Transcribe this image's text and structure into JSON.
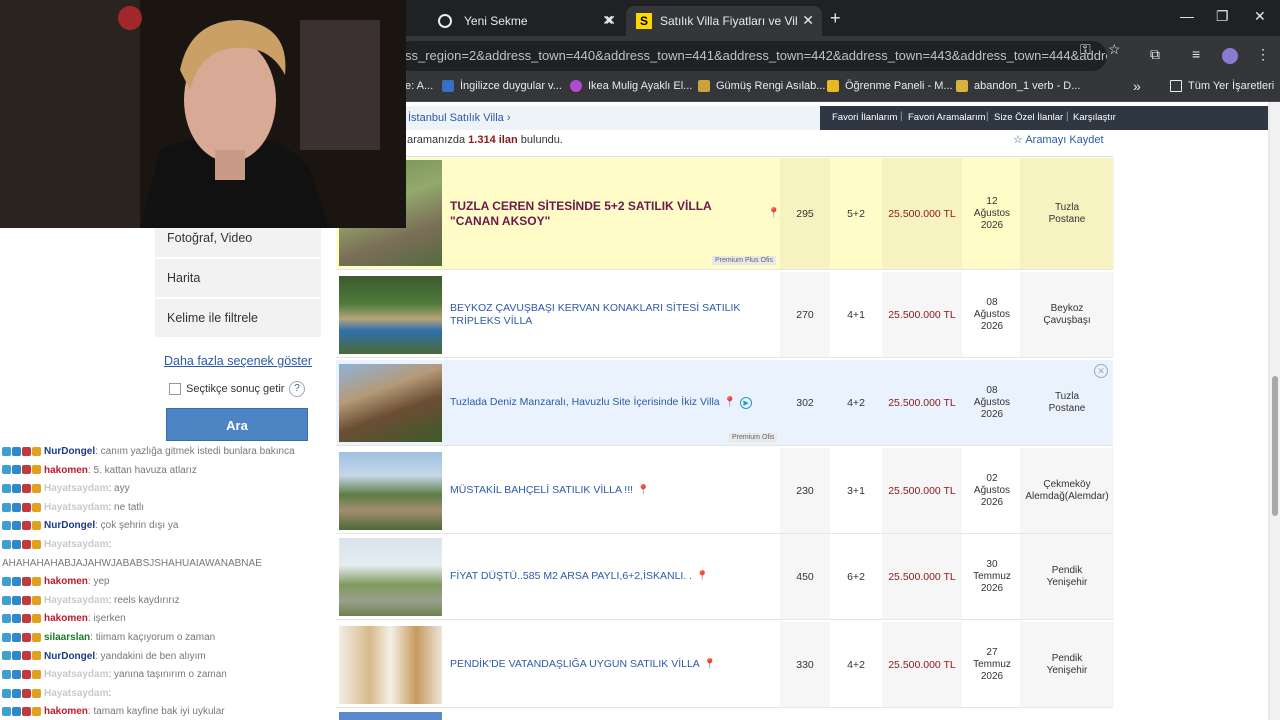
{
  "browser": {
    "tabs": [
      {
        "label": "Yeni Sekme",
        "active": false
      },
      {
        "label": "Satılık Villa Fiyatları ve Villa İlanları",
        "active": true
      }
    ],
    "url": "ss_region=2&address_town=440&address_town=441&address_town=442&address_town=443&address_town=444&address_t...",
    "bookmarks": [
      {
        "label": "e: A..."
      },
      {
        "label": "İngilizce duygular v..."
      },
      {
        "label": "Ikea Mulig Ayaklı El..."
      },
      {
        "label": "Gümüş Rengi Asılab..."
      },
      {
        "label": "Öğrenme Paneli - M..."
      },
      {
        "label": "abandon_1 verb - D..."
      }
    ],
    "bookmarks_overflow": "»",
    "all_bookmarks": "Tüm Yer İşaretleri"
  },
  "page": {
    "breadcrumb": "İstanbul Satılık Villa",
    "breadcrumb_sep": "›",
    "user_links": [
      "Favori İlanlarım",
      "Favori Aramalarım",
      "Size Özel İlanlar",
      "Karşılaştır"
    ],
    "result_prefix": "aramanızda",
    "result_count": "1.314 ilan",
    "result_suffix": "bulundu.",
    "save_search": "Aramayı Kaydet"
  },
  "sidebar": {
    "items": [
      "Fotoğraf, Video",
      "Harita",
      "Kelime ile filtrele"
    ],
    "more_filters": "Daha fazla seçenek göster",
    "checkbox_label": "Seçtikçe sonuç getir",
    "help": "?",
    "search_button": "Ara"
  },
  "listings": [
    {
      "title": "TUZLA CEREN SİTESİNDE 5+2 SATILIK VİLLA \"CANAN AKSOY\"",
      "m2": "295",
      "rooms": "5+2",
      "price": "25.500.000 TL",
      "date": [
        "12",
        "Ağustos",
        "2026"
      ],
      "loc": [
        "Tuzla",
        "Postane"
      ],
      "badge": "Premium Plus Ofis"
    },
    {
      "title": "BEYKOZ ÇAVUŞBAŞI KERVAN KONAKLARI SİTESİ SATILIK TRİPLEKS VİLLA",
      "m2": "270",
      "rooms": "4+1",
      "price": "25.500.000 TL",
      "date": [
        "08",
        "Ağustos",
        "2026"
      ],
      "loc": [
        "Beykoz",
        "Çavuşbaşı"
      ],
      "badge": ""
    },
    {
      "title": "Tuzlada Deniz Manzaralı, Havuzlu Site İçerisinde İkiz Villa",
      "m2": "302",
      "rooms": "4+2",
      "price": "25.500.000 TL",
      "date": [
        "08",
        "Ağustos",
        "2026"
      ],
      "loc": [
        "Tuzla",
        "Postane"
      ],
      "badge": "Premium Ofis"
    },
    {
      "title": "MÜSTAKİL BAHÇELİ SATILIK VİLLA !!!",
      "m2": "230",
      "rooms": "3+1",
      "price": "25.500.000 TL",
      "date": [
        "02",
        "Ağustos",
        "2026"
      ],
      "loc": [
        "Çekmeköy",
        "Alemdağ(Alemdar)"
      ],
      "badge": ""
    },
    {
      "title": "FİYAT DÜŞTÜ..585 M2 ARSA PAYLI,6+2,İSKANLI. .",
      "m2": "450",
      "rooms": "6+2",
      "price": "25.500.000 TL",
      "date": [
        "30",
        "Temmuz",
        "2026"
      ],
      "loc": [
        "Pendik",
        "Yenişehir"
      ],
      "badge": ""
    },
    {
      "title": "PENDİK'DE VATANDAŞLIĞA UYGUN SATILIK VİLLA",
      "m2": "330",
      "rooms": "4+2",
      "price": "25.500.000 TL",
      "date": [
        "27",
        "Temmuz",
        "2026"
      ],
      "loc": [
        "Pendik",
        "Yenişehir"
      ],
      "badge": ""
    }
  ],
  "chat": [
    {
      "user": "NurDongel",
      "msg": ": canım yazlığa gitmek istedi bunlara bakınca",
      "color": "#1a3a8a"
    },
    {
      "user": "hakomen",
      "msg": ": 5. kattan havuza atlarız",
      "color": "#c0182c"
    },
    {
      "user": "Hayatsaydam",
      "msg": ": ayy",
      "color": "#c9c9c9"
    },
    {
      "user": "Hayatsaydam",
      "msg": ": ne tatlı",
      "color": "#c9c9c9"
    },
    {
      "user": "NurDongel",
      "msg": ": çok şehrin dışı ya",
      "color": "#1a3a8a"
    },
    {
      "user": "Hayatsaydam",
      "msg": ":",
      "color": "#c9c9c9"
    },
    {
      "user": "",
      "msg": "AHAHAHAHABJAJAHWJABABSJSHAHUAIAWANABNAE",
      "color": "#999"
    },
    {
      "user": "hakomen",
      "msg": ": yep",
      "color": "#c0182c"
    },
    {
      "user": "Hayatsaydam",
      "msg": ": reels kaydırırız",
      "color": "#c9c9c9"
    },
    {
      "user": "hakomen",
      "msg": ": işerken",
      "color": "#c0182c"
    },
    {
      "user": "silaarslan",
      "msg": ": tiimam kaçıyorum o zaman",
      "color": "#1a7a2a"
    },
    {
      "user": "NurDongel",
      "msg": ": yandakini de ben alıyım",
      "color": "#1a3a8a"
    },
    {
      "user": "Hayatsaydam",
      "msg": ": yanına taşınırım o zaman",
      "color": "#c9c9c9"
    },
    {
      "user": "Hayatsaydam",
      "msg": ":",
      "color": "#c9c9c9"
    },
    {
      "user": "hakomen",
      "msg": ": tamam kayfine bak iyi uykular",
      "color": "#c0182c"
    }
  ],
  "colors": {
    "accent": "#4c84c4",
    "price": "#8b1a1a",
    "link": "#2b5aa8",
    "premium_row": "#fffcc8"
  },
  "icons": [
    "search-icon",
    "key-icon",
    "star-icon",
    "extensions-icon",
    "media-icon",
    "profile-icon",
    "menu-icon",
    "folder-icon",
    "pin-icon",
    "play-icon",
    "close-icon"
  ]
}
